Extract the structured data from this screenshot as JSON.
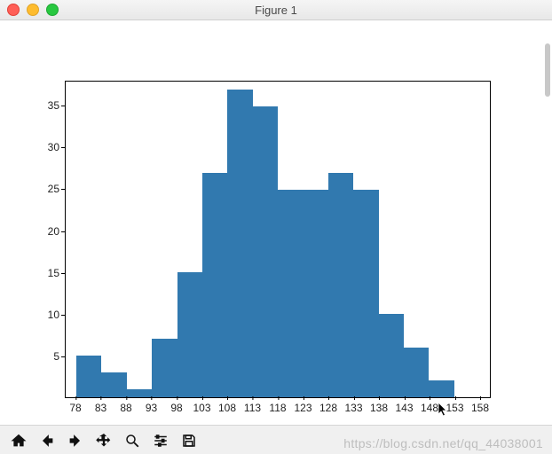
{
  "window": {
    "title": "Figure 1"
  },
  "chart_data": {
    "type": "bar",
    "title": "",
    "xlabel": "",
    "ylabel": "",
    "categories": [
      78,
      83,
      88,
      93,
      98,
      103,
      108,
      113,
      118,
      123,
      128,
      133,
      138,
      143,
      148,
      153,
      158
    ],
    "values": [
      5,
      3,
      1,
      7,
      15,
      27,
      37,
      35,
      25,
      25,
      27,
      25,
      10,
      6,
      2,
      0
    ],
    "ylim": [
      0,
      38
    ],
    "yticks": [
      5,
      10,
      15,
      20,
      25,
      30,
      35
    ],
    "bar_color": "#3179af"
  },
  "toolbar": {
    "home": "Home",
    "back": "Back",
    "forward": "Forward",
    "pan": "Pan",
    "zoom": "Zoom",
    "subplots": "Configure subplots",
    "save": "Save"
  },
  "watermark": "https://blog.csdn.net/qq_44038001"
}
